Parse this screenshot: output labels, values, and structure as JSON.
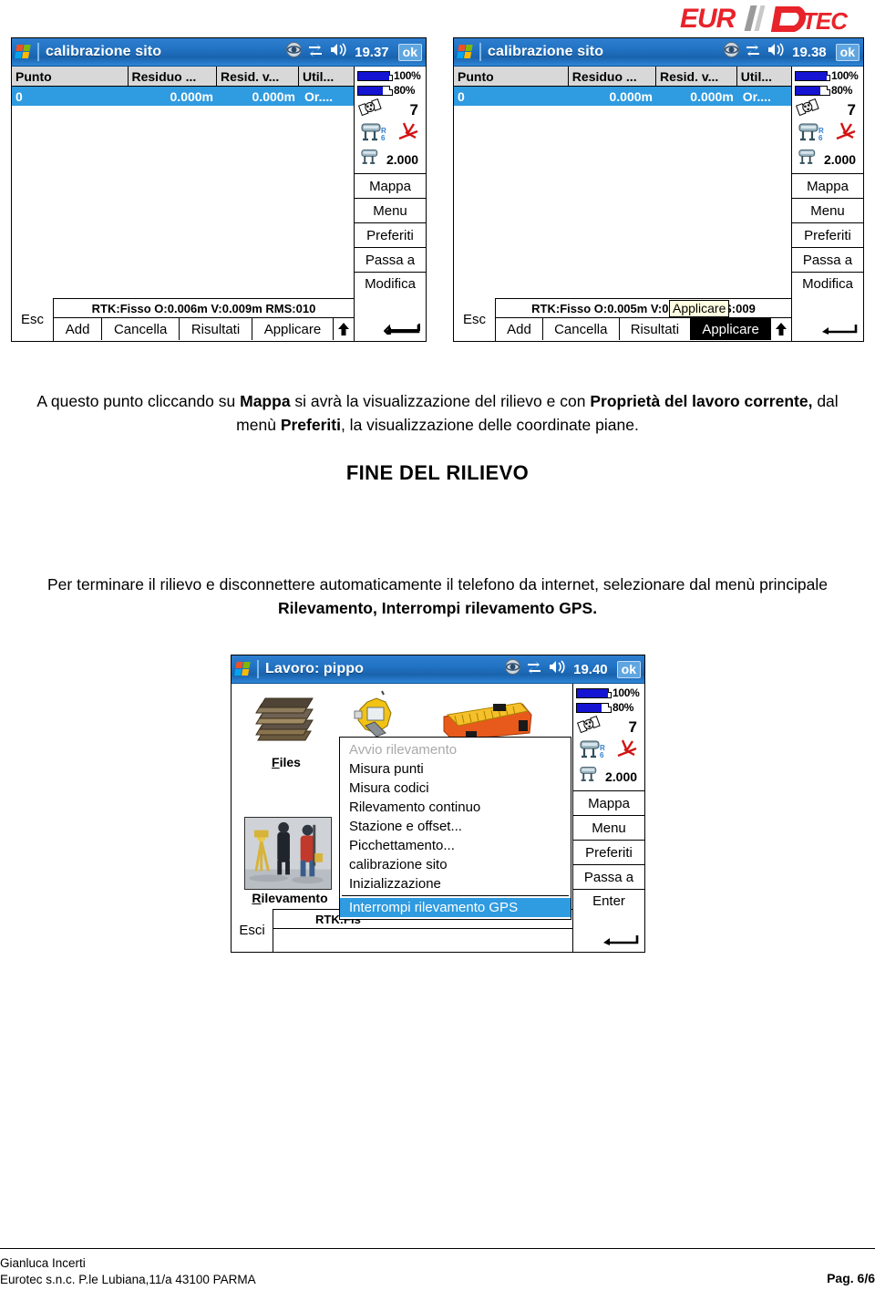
{
  "logo": {
    "text_left": "EUR",
    "text_right": "TEC",
    "alt": "eurotec-logo",
    "color_red": "#e8232a",
    "color_grey": "#8b8b8b"
  },
  "screens": [
    {
      "id": "calibrazione-1",
      "titlebar": {
        "title": "calibrazione sito",
        "time": "19.37",
        "ok": "ok",
        "icons": [
          "internet-explorer-icon",
          "connectivity-icon",
          "volume-icon"
        ]
      },
      "table": {
        "headers": [
          "Punto",
          "Residuo ...",
          "Resid. v...",
          "Util..."
        ],
        "rows": [
          [
            "0",
            "0.000m",
            "0.000m",
            "Or...."
          ]
        ]
      },
      "status": "RTK:Fisso O:0.006m V:0.009m RMS:010",
      "esc": "Esc",
      "softkeys": [
        "Add",
        "Cancella",
        "Risultati",
        "Applicare"
      ],
      "pressed_softkey": null,
      "tooltip": null,
      "sidebar": {
        "battery_main": {
          "label": "100%",
          "fill": 100
        },
        "battery_second": {
          "label": "80%",
          "fill": 80
        },
        "satellites": "7",
        "antenna_tag": "R6",
        "antenna_height": "2.000",
        "buttons": [
          "Mappa",
          "Menu",
          "Preferiti",
          "Passa a"
        ],
        "action": "Modifica"
      }
    },
    {
      "id": "calibrazione-2",
      "titlebar": {
        "title": "calibrazione sito",
        "time": "19.38",
        "ok": "ok",
        "icons": [
          "internet-explorer-icon",
          "connectivity-icon",
          "volume-icon"
        ]
      },
      "table": {
        "headers": [
          "Punto",
          "Residuo ...",
          "Resid. v...",
          "Util..."
        ],
        "rows": [
          [
            "0",
            "0.000m",
            "0.000m",
            "Or...."
          ]
        ]
      },
      "status": "RTK:Fisso O:0.005m V:0.008m RMS:009",
      "esc": "Esc",
      "softkeys": [
        "Add",
        "Cancella",
        "Risultati",
        "Applicare"
      ],
      "pressed_softkey": "Applicare",
      "tooltip": "Applicare",
      "sidebar": {
        "battery_main": {
          "label": "100%",
          "fill": 100
        },
        "battery_second": {
          "label": "80%",
          "fill": 80
        },
        "satellites": "7",
        "antenna_tag": "R6",
        "antenna_height": "2.000",
        "buttons": [
          "Mappa",
          "Menu",
          "Preferiti",
          "Passa a"
        ],
        "action": "Modifica"
      }
    },
    {
      "id": "lavoro-pippo",
      "titlebar": {
        "title": "Lavoro: pippo",
        "time": "19.40",
        "ok": "ok",
        "icons": [
          "internet-explorer-icon",
          "connectivity-icon",
          "volume-icon"
        ]
      },
      "icons": [
        {
          "name": "files-icon",
          "label": "Files",
          "accesskey": "F"
        },
        {
          "name": "rilevamento-icon",
          "label": "Rilevamento",
          "accesskey": "R"
        }
      ],
      "menu": [
        {
          "label": "Avvio rilevamento",
          "accesskey": "A",
          "state": "disabled"
        },
        {
          "label": "Misura punti",
          "accesskey": "M",
          "state": "normal"
        },
        {
          "label": "Misura codici",
          "accesskey": "M",
          "state": "normal"
        },
        {
          "label": "Rilevamento continuo",
          "accesskey": "R",
          "state": "normal"
        },
        {
          "label": "Stazione e offset...",
          "accesskey": "S",
          "state": "normal"
        },
        {
          "label": "Picchettamento...",
          "accesskey": "P",
          "state": "normal"
        },
        {
          "label": "calibrazione sito",
          "accesskey": "c",
          "state": "normal"
        },
        {
          "label": "Inizializzazione",
          "accesskey": "I",
          "state": "normal"
        },
        {
          "label": "Interrompi rilevamento GPS",
          "accesskey": "I",
          "state": "selected"
        }
      ],
      "status": "RTK:Fis",
      "esc": "Esci",
      "sidebar": {
        "battery_main": {
          "label": "100%",
          "fill": 100
        },
        "battery_second": {
          "label": "80%",
          "fill": 80
        },
        "satellites": "7",
        "antenna_tag": "R6",
        "antenna_height": "2.000",
        "buttons": [
          "Mappa",
          "Menu",
          "Preferiti",
          "Passa a"
        ],
        "action": "Enter"
      }
    }
  ],
  "document": {
    "paragraph1": {
      "p1": "A questo punto cliccando su ",
      "b1": "Mappa",
      "p2": " si avrà la visualizzazione del rilievo e con ",
      "b2": "Proprietà del lavoro corrente,",
      "p3": " dal menù ",
      "b3": "Preferiti",
      "p4": ", la visualizzazione delle coordinate piane."
    },
    "heading": "FINE DEL RILIEVO",
    "paragraph2": {
      "p1": "Per terminare il rilievo e disconnettere automaticamente il telefono da internet, selezionare dal menù principale ",
      "b1": "Rilevamento,",
      "p2": "  ",
      "b2": "Interrompi rilevamento GPS."
    }
  },
  "footer": {
    "line1": "Gianluca Incerti",
    "line2": "Eurotec s.n.c. P.le Lubiana,11/a 43100 PARMA",
    "page": "Pag. 6/6"
  }
}
